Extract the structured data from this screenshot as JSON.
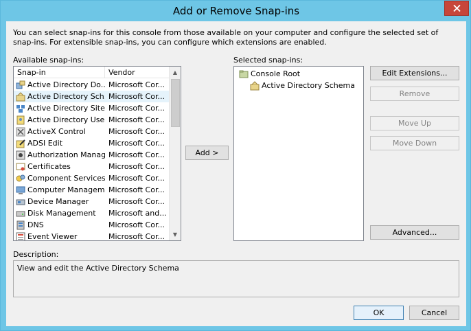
{
  "window": {
    "title": "Add or Remove Snap-ins",
    "close_icon": "close-icon"
  },
  "intro_text": "You can select snap-ins for this console from those available on your computer and configure the selected set of snap-ins. For extensible snap-ins, you can configure which extensions are enabled.",
  "available": {
    "label": "Available snap-ins:",
    "columns": [
      "Snap-in",
      "Vendor"
    ],
    "rows": [
      {
        "name": "Active Directory Do...",
        "vendor": "Microsoft Cor...",
        "icon": "ad-domains-icon"
      },
      {
        "name": "Active Directory Sch...",
        "vendor": "Microsoft Cor...",
        "icon": "ad-schema-icon"
      },
      {
        "name": "Active Directory Site...",
        "vendor": "Microsoft Cor...",
        "icon": "ad-sites-icon"
      },
      {
        "name": "Active Directory Use...",
        "vendor": "Microsoft Cor...",
        "icon": "ad-users-icon"
      },
      {
        "name": "ActiveX Control",
        "vendor": "Microsoft Cor...",
        "icon": "activex-icon"
      },
      {
        "name": "ADSI Edit",
        "vendor": "Microsoft Cor...",
        "icon": "adsi-edit-icon"
      },
      {
        "name": "Authorization Manager",
        "vendor": "Microsoft Cor...",
        "icon": "authorization-icon"
      },
      {
        "name": "Certificates",
        "vendor": "Microsoft Cor...",
        "icon": "certificates-icon"
      },
      {
        "name": "Component Services",
        "vendor": "Microsoft Cor...",
        "icon": "component-services-icon"
      },
      {
        "name": "Computer Managem...",
        "vendor": "Microsoft Cor...",
        "icon": "computer-management-icon"
      },
      {
        "name": "Device Manager",
        "vendor": "Microsoft Cor...",
        "icon": "device-manager-icon"
      },
      {
        "name": "Disk Management",
        "vendor": "Microsoft and...",
        "icon": "disk-management-icon"
      },
      {
        "name": "DNS",
        "vendor": "Microsoft Cor...",
        "icon": "dns-icon"
      },
      {
        "name": "Event Viewer",
        "vendor": "Microsoft Cor...",
        "icon": "event-viewer-icon"
      }
    ],
    "selected_index": 1
  },
  "add_button": "Add >",
  "selected": {
    "label": "Selected snap-ins:",
    "root": "Console Root",
    "child": "Active Directory Schema"
  },
  "side_buttons": {
    "edit_extensions": "Edit Extensions...",
    "remove": "Remove",
    "move_up": "Move Up",
    "move_down": "Move Down",
    "advanced": "Advanced..."
  },
  "description": {
    "label": "Description:",
    "text": "View and edit the Active Directory Schema"
  },
  "footer": {
    "ok": "OK",
    "cancel": "Cancel"
  },
  "colors": {
    "title_bar": "#6ec6e6",
    "close_button": "#c7463a",
    "selection": "#e5f3fb"
  }
}
